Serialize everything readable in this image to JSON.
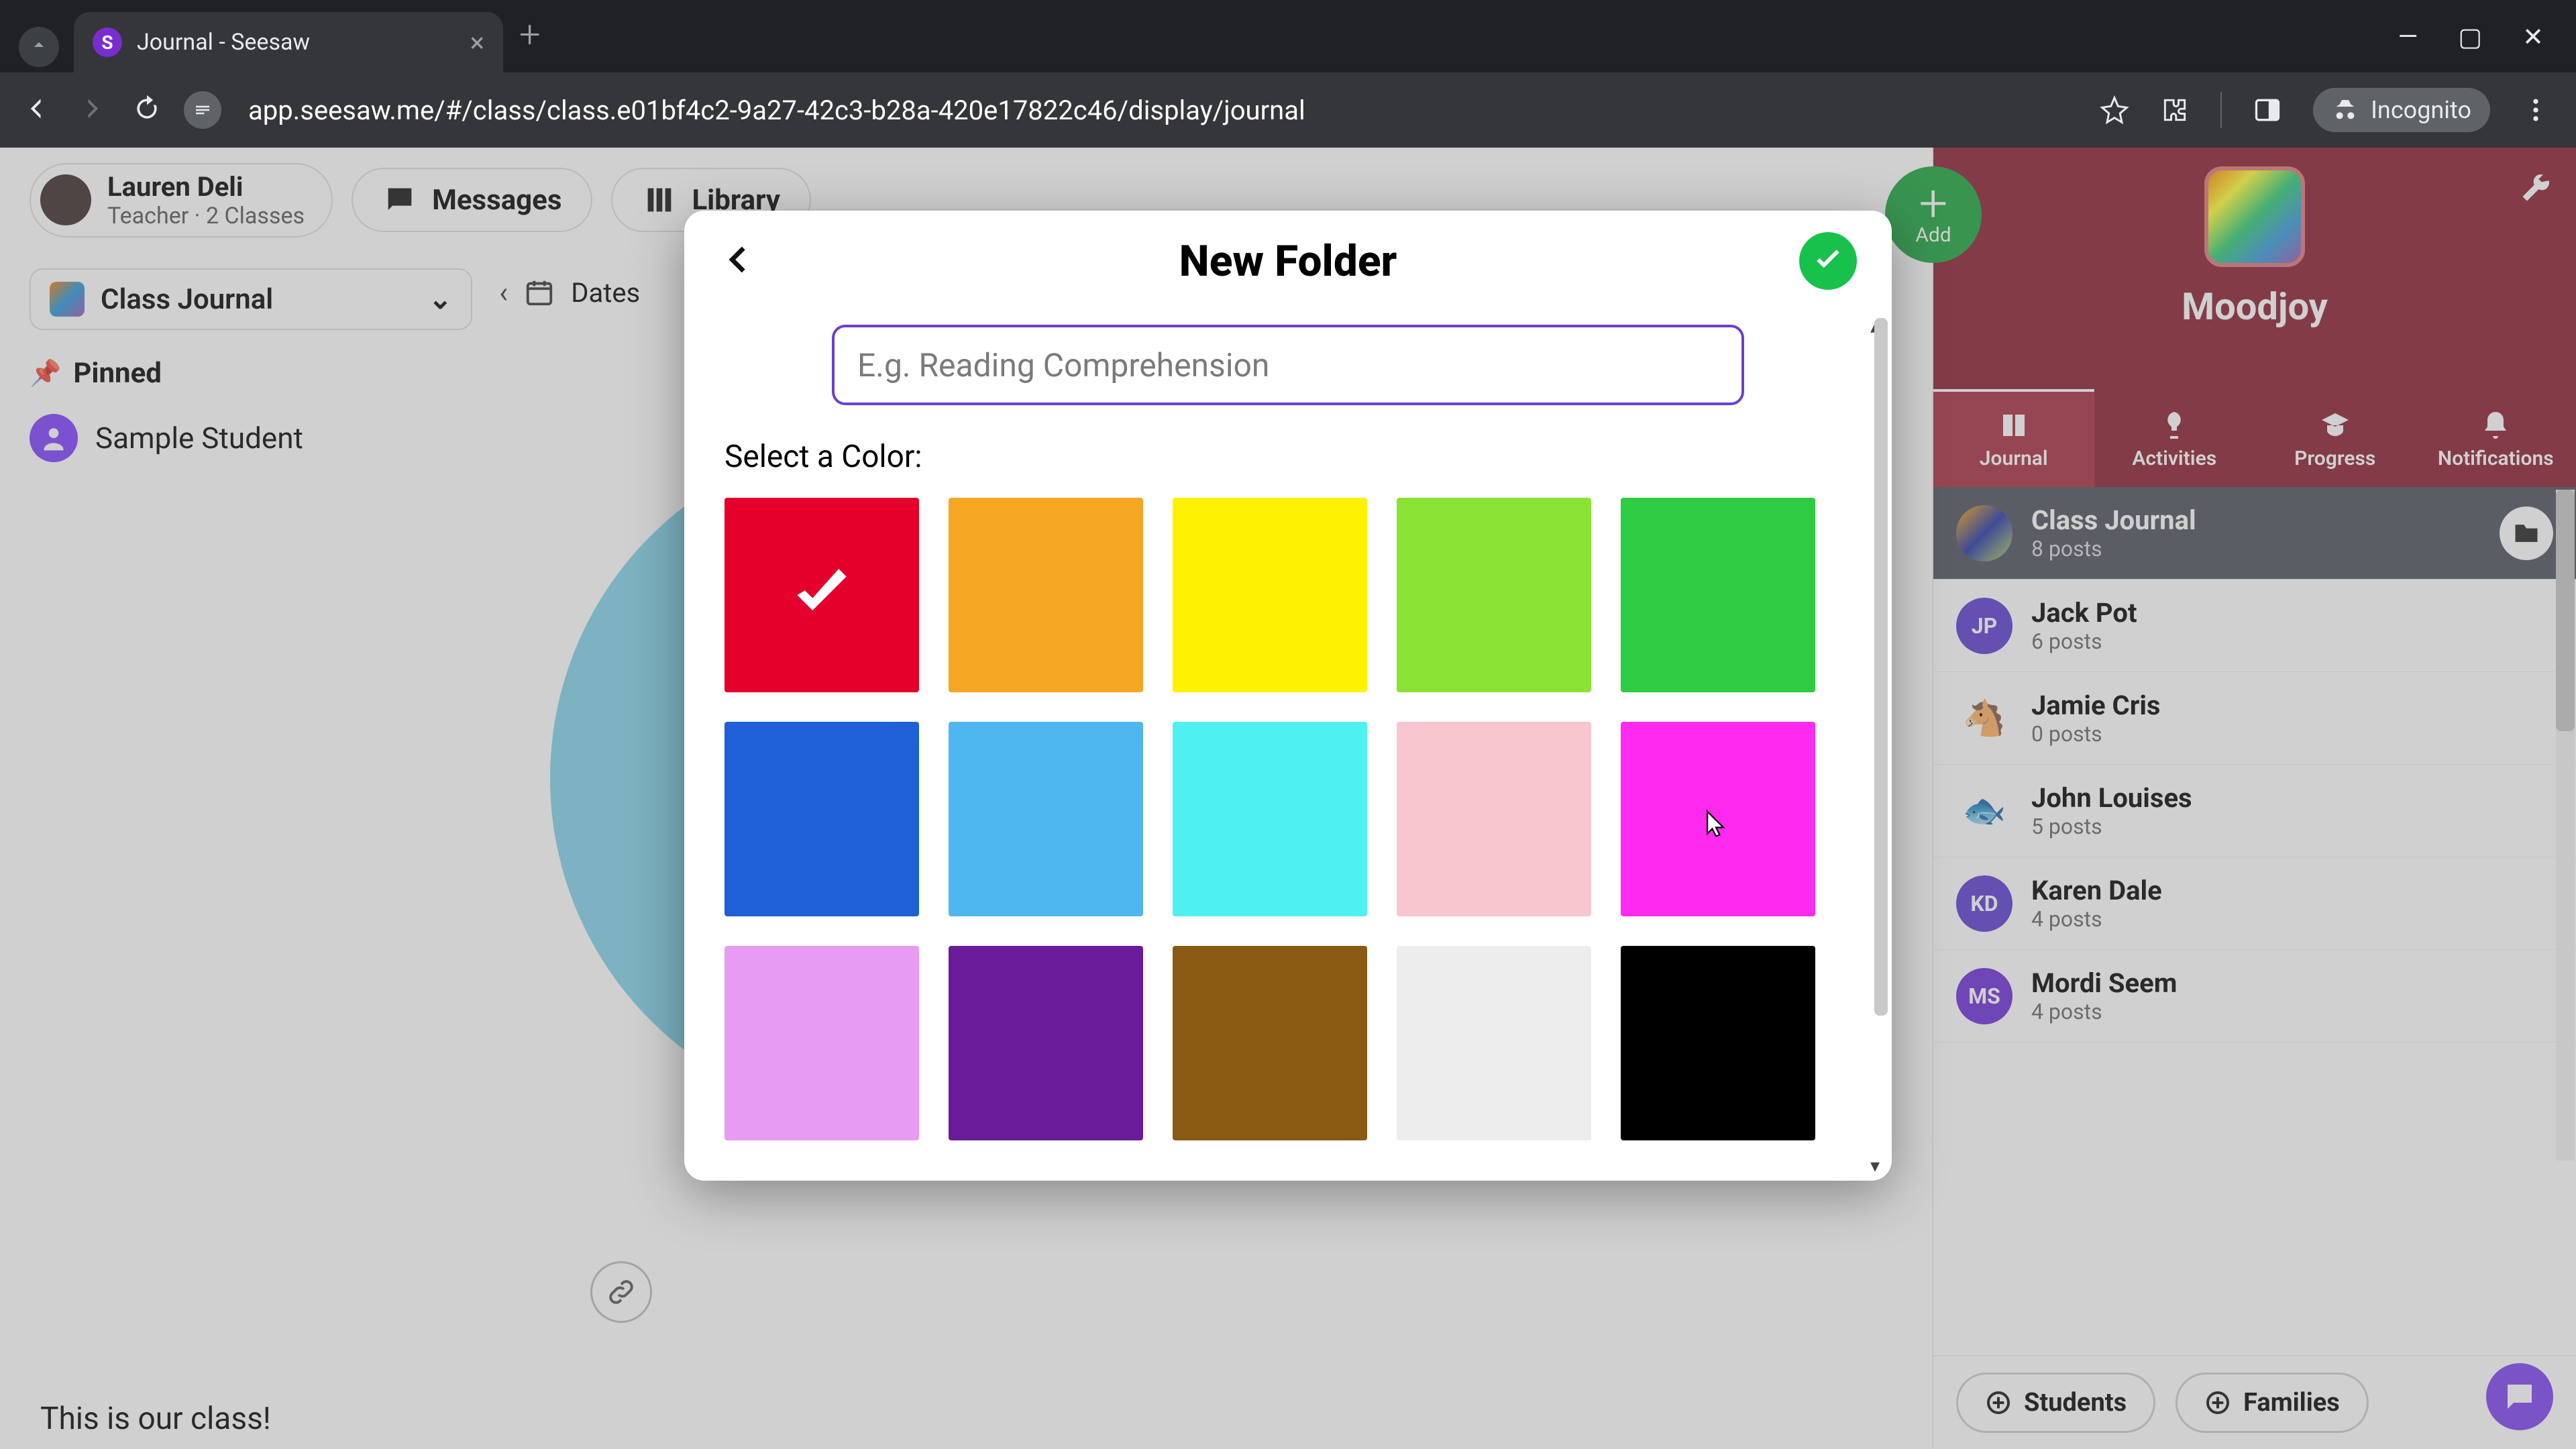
{
  "browser": {
    "tab_title": "Journal - Seesaw",
    "incognito_label": "Incognito",
    "url_display": "app.seesaw.me/#/class/class.e01bf4c2-9a27-42c3-b28a-420e17822c46/display/journal"
  },
  "header": {
    "teacher_name": "Lauren Deli",
    "teacher_sub": "Teacher · 2 Classes",
    "tabs": {
      "messages": "Messages",
      "library": "Library"
    }
  },
  "left": {
    "journal_dropdown": "Class Journal",
    "pinned_label": "Pinned",
    "sample_student": "Sample Student",
    "dates_label": "Dates",
    "caption": "This is our class!"
  },
  "brand": {
    "class_name": "Moodjoy",
    "add_label": "Add"
  },
  "rail_tabs": {
    "journal": "Journal",
    "activities": "Activities",
    "progress": "Progress",
    "notifications": "Notifications"
  },
  "rail_list": [
    {
      "title": "Class Journal",
      "sub": "8 posts",
      "avatar": "img",
      "selected": true,
      "folder": true
    },
    {
      "title": "Jack Pot",
      "sub": "6 posts",
      "avatar": "JP",
      "color": "#5a3bcf"
    },
    {
      "title": "Jamie Cris",
      "sub": "0 posts",
      "avatar": "🐴",
      "emoji": true
    },
    {
      "title": "John Louises",
      "sub": "5 posts",
      "avatar": "🐟",
      "emoji": true
    },
    {
      "title": "Karen Dale",
      "sub": "4 posts",
      "avatar": "KD",
      "color": "#5a3bcf"
    },
    {
      "title": "Mordi Seem",
      "sub": "4 posts",
      "avatar": "MS",
      "color": "#6b2bd6"
    }
  ],
  "rail_footer": {
    "students": "Students",
    "families": "Families"
  },
  "modal": {
    "title": "New Folder",
    "placeholder": "E.g. Reading Comprehension",
    "select_color_label": "Select a Color:",
    "colors": [
      "#e4002b",
      "#f5a623",
      "#fff200",
      "#8ae234",
      "#2ecc40",
      "#1f5fd8",
      "#4fb7f0",
      "#4ff0f0",
      "#f7c6cf",
      "#ff29ef",
      "#e89bf2",
      "#6a1b9a",
      "#8a5a12",
      "#ededed",
      "#000000"
    ],
    "selected_index": 0,
    "cursor_on_index": 9
  }
}
